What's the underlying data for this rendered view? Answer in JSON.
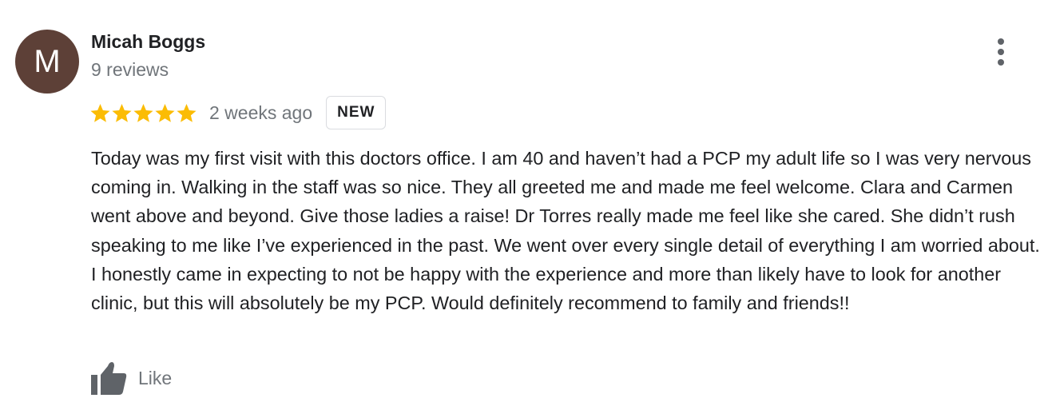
{
  "reviewer": {
    "initial": "M",
    "name": "Micah Boggs",
    "review_count": "9 reviews",
    "avatar_color": "#5d4037"
  },
  "review": {
    "rating": 5,
    "max_rating": 5,
    "date": "2 weeks ago",
    "badge": "NEW",
    "text": "Today was my first visit with this doctors office. I am 40 and haven’t had a PCP my adult life so I was very nervous coming in. Walking in the staff was so nice. They all greeted me and made me feel welcome. Clara and Carmen went above and beyond. Give those ladies a raise! Dr Torres really made me feel like she cared. She didn’t rush speaking to me like I’ve experienced in the past. We went over every single detail of everything I am worried about. I honestly came in expecting to not be happy with the experience and more than likely have to look for another clinic, but this will absolutely be my PCP. Would definitely recommend to family and friends!!"
  },
  "actions": {
    "like_label": "Like",
    "like_icon": "thumbs-up-icon",
    "more_icon": "more-vert-icon"
  },
  "colors": {
    "star": "#fbbc04",
    "muted_text": "#70757a",
    "icon_gray": "#5f6368"
  }
}
